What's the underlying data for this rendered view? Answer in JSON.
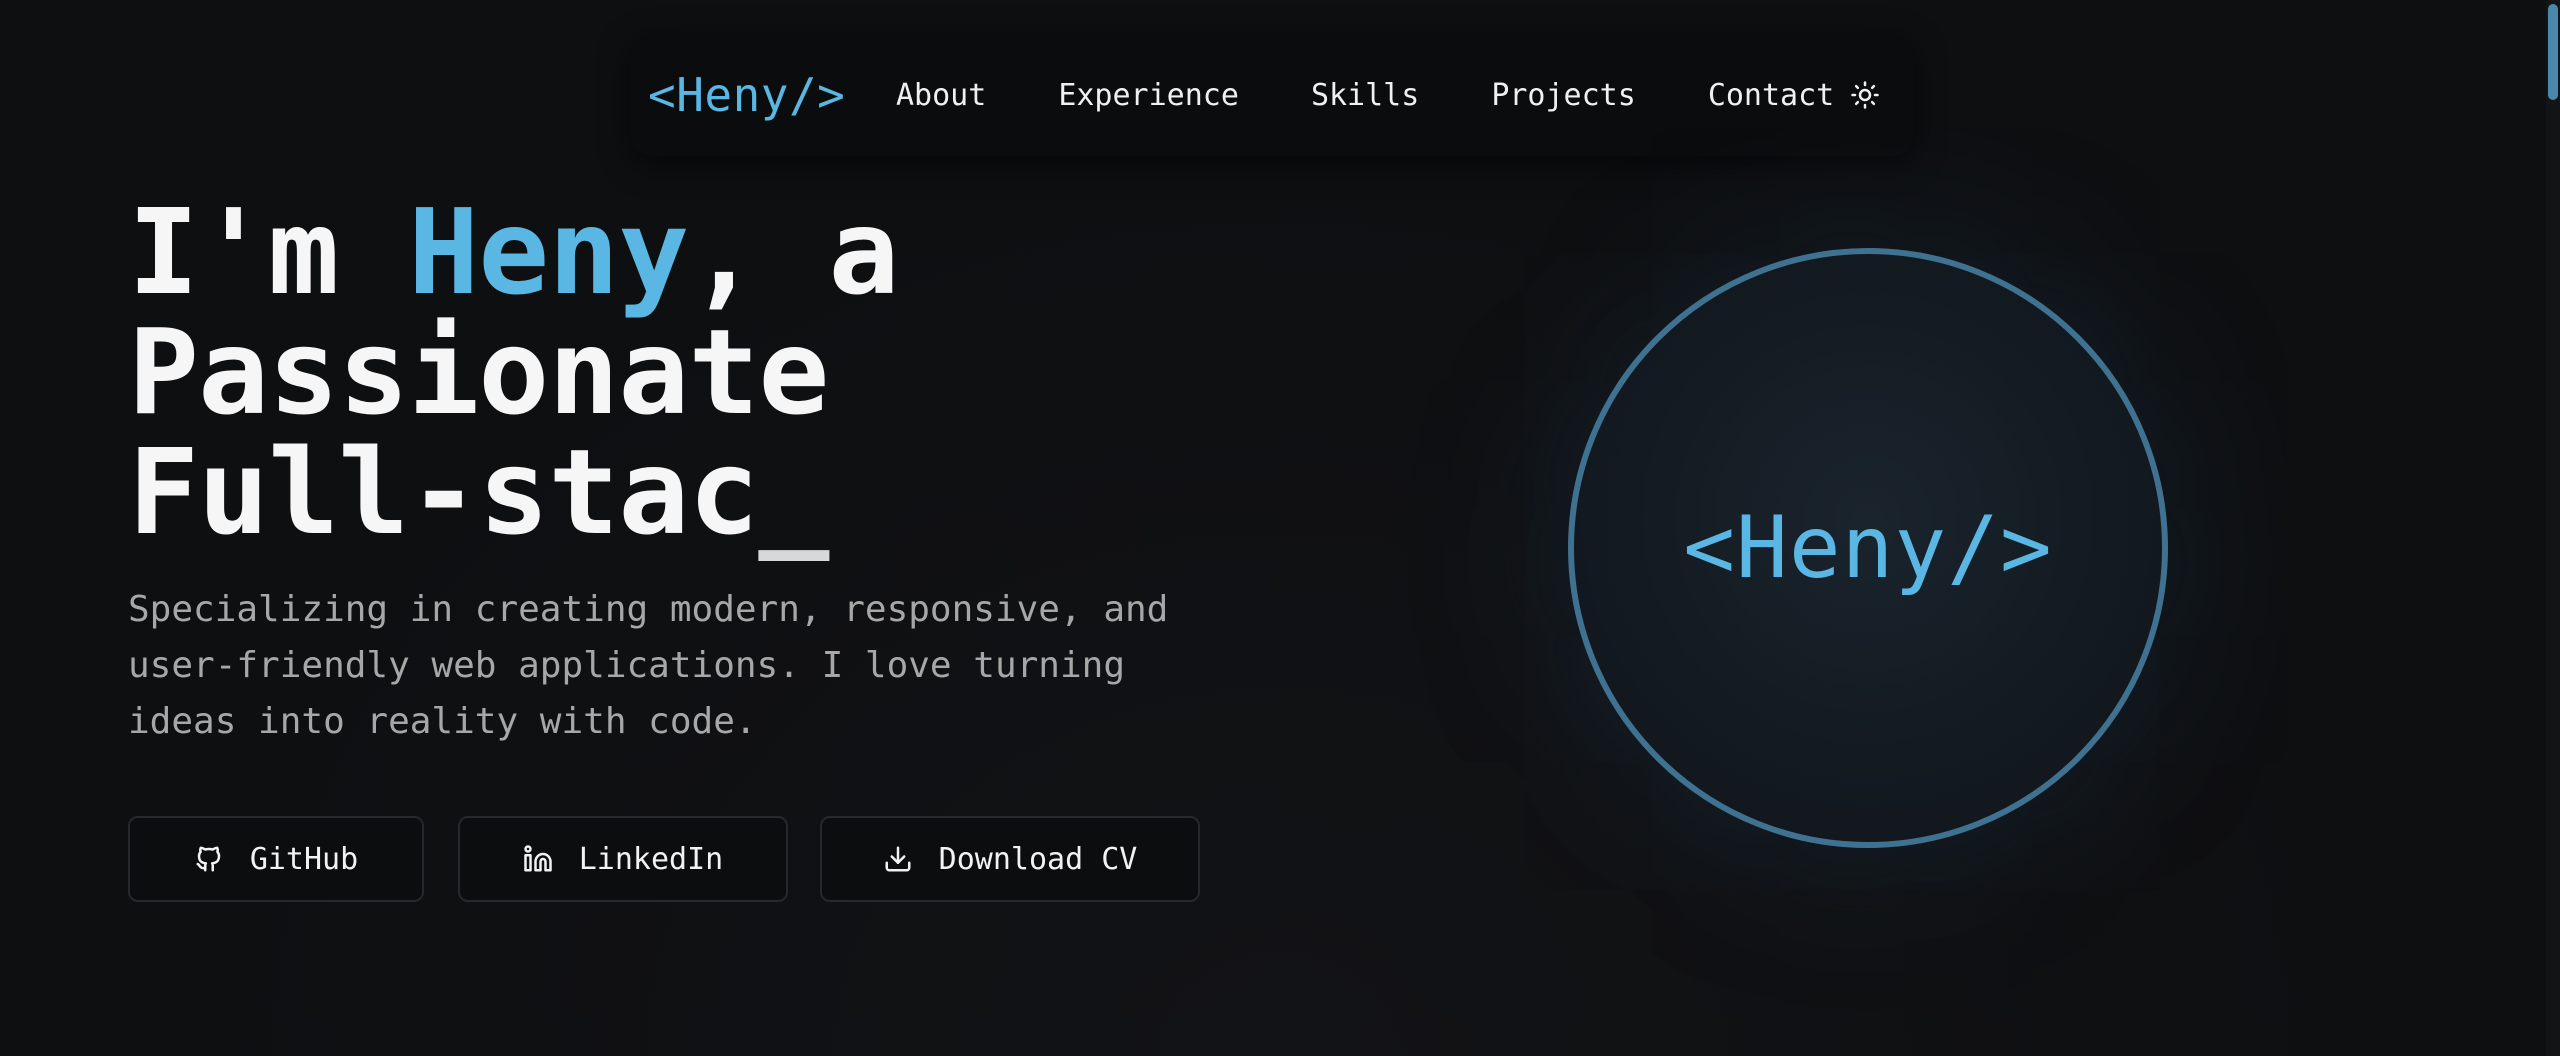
{
  "nav": {
    "brand": "<Heny/>",
    "links": [
      "About",
      "Experience",
      "Skills",
      "Projects",
      "Contact"
    ],
    "theme_toggle_icon": "sun-icon"
  },
  "hero": {
    "title_prefix": "I'm ",
    "title_name": "Heny",
    "title_suffix": ", a",
    "title_line2": "Passionate",
    "title_line3": "Full-stac",
    "cursor": "_",
    "subtitle_lines": [
      "Specializing in creating modern, responsive, and",
      "user-friendly web applications. I love turning",
      "ideas into reality with code."
    ]
  },
  "buttons": {
    "github": {
      "label": "GitHub",
      "icon": "github-icon"
    },
    "linkedin": {
      "label": "LinkedIn",
      "icon": "linkedin-icon"
    },
    "download_cv": {
      "label": "Download CV",
      "icon": "download-icon"
    }
  },
  "logo": {
    "text": "<Heny/>"
  },
  "colors": {
    "accent": "#5ab7e4",
    "background": "#0e0f11",
    "circle_border": "#3f7190"
  }
}
